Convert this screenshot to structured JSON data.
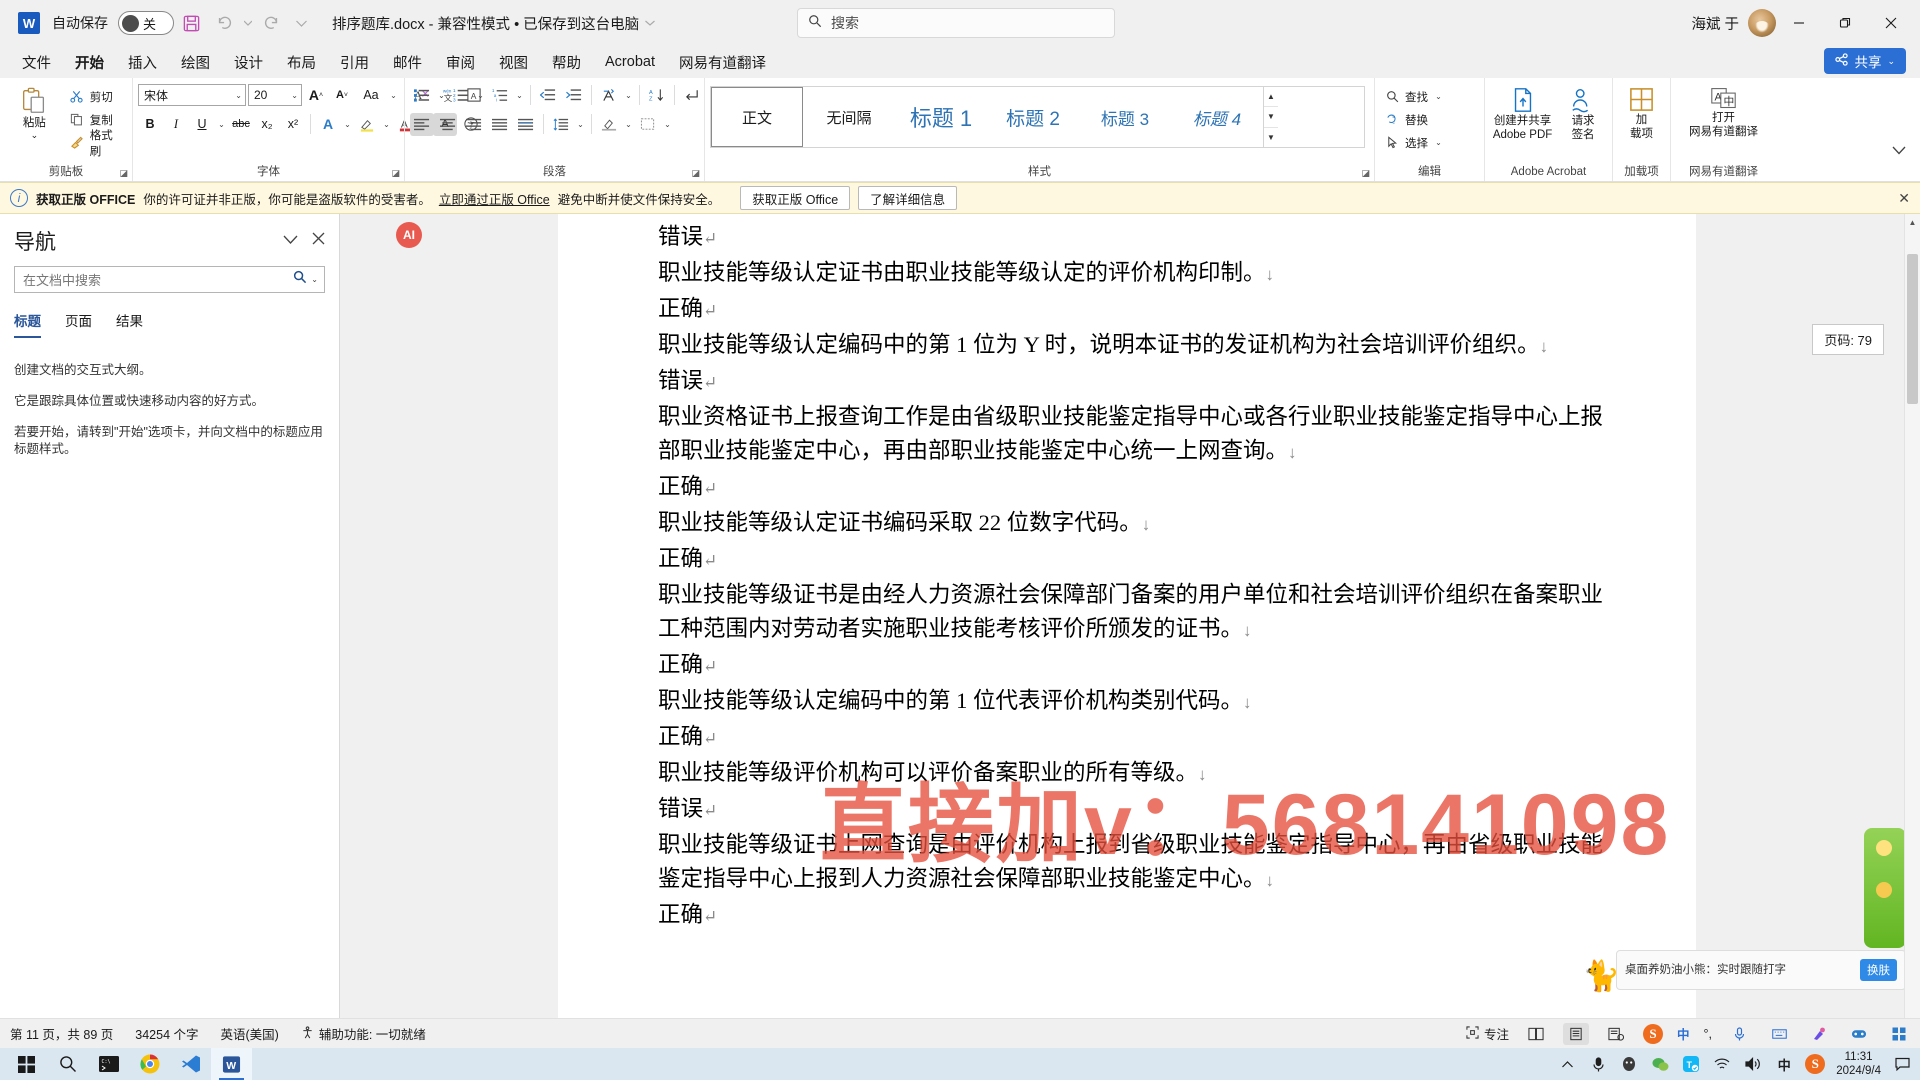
{
  "titlebar": {
    "app_icon": "word-logo",
    "autosave_label": "自动保存",
    "autosave_state": "关",
    "save_icon": "save-icon",
    "undo_icon": "undo-icon",
    "redo_icon": "redo-icon",
    "customize_icon": "chevron-down-icon",
    "doc_title": "排序题库.docx  -  兼容性模式 • 已保存到这台电脑",
    "user_name": "海斌 于",
    "minimize": "—",
    "maximize": "▢",
    "close": "✕"
  },
  "search": {
    "placeholder": "搜索",
    "icon": "search-icon"
  },
  "tabs": [
    {
      "label": "文件",
      "active": false
    },
    {
      "label": "开始",
      "active": true
    },
    {
      "label": "插入",
      "active": false
    },
    {
      "label": "绘图",
      "active": false
    },
    {
      "label": "设计",
      "active": false
    },
    {
      "label": "布局",
      "active": false
    },
    {
      "label": "引用",
      "active": false
    },
    {
      "label": "邮件",
      "active": false
    },
    {
      "label": "审阅",
      "active": false
    },
    {
      "label": "视图",
      "active": false
    },
    {
      "label": "帮助",
      "active": false
    },
    {
      "label": "Acrobat",
      "active": false
    },
    {
      "label": "网易有道翻译",
      "active": false
    }
  ],
  "share_button": {
    "label": "共享",
    "icon": "share-icon",
    "caret": "⌄",
    "color": "#2b6fd4"
  },
  "ribbon": {
    "clipboard": {
      "group_label": "剪贴板",
      "paste_label": "粘贴",
      "paste_caret": "⌄",
      "items": [
        {
          "label": "剪切",
          "icon": "scissors-icon"
        },
        {
          "label": "复制",
          "icon": "copy-icon"
        },
        {
          "label": "格式刷",
          "icon": "format-painter-icon"
        }
      ]
    },
    "font": {
      "group_label": "字体",
      "font_name": "宋体",
      "font_size": "20",
      "grow_icon": "grow-font-icon",
      "shrink_icon": "shrink-font-icon",
      "change_case": "Aa",
      "clear_format_icon": "clear-formatting-icon",
      "phonetic_icon": "phonetic-guide-icon",
      "char_border_icon": "character-border-icon",
      "bold": "B",
      "italic": "I",
      "underline": "U",
      "strike": "abc",
      "subscript": "x₂",
      "superscript": "x²",
      "text_effects_icon": "text-effects-icon",
      "highlight_icon": "highlight-color-icon",
      "font_color_icon": "font-color-icon",
      "char_shading_icon": "character-shading-icon",
      "enclose_icon": "enclose-character-icon"
    },
    "paragraph": {
      "group_label": "段落",
      "bullets_icon": "bullet-list-icon",
      "numbering_icon": "numbered-list-icon",
      "multilevel_icon": "multilevel-list-icon",
      "decrease_indent_icon": "decrease-indent-icon",
      "increase_indent_icon": "increase-indent-icon",
      "sort_cn_icon": "sort-chinese-icon",
      "sort_icon": "sort-az-icon",
      "show_marks_icon": "show-formatting-marks-icon",
      "align_left_icon": "align-left-icon",
      "align_center_icon": "align-center-icon",
      "align_right_icon": "align-right-icon",
      "justify_icon": "justify-icon",
      "distribute_icon": "distribute-icon",
      "line_spacing_icon": "line-spacing-icon",
      "shading_icon": "shading-icon",
      "borders_icon": "borders-icon"
    },
    "styles": {
      "group_label": "样式",
      "items": [
        {
          "label": "正文",
          "selected": true
        },
        {
          "label": "无间隔",
          "selected": false
        },
        {
          "label": "标题 1",
          "selected": false
        },
        {
          "label": "标题 2",
          "selected": false
        },
        {
          "label": "标题 3",
          "selected": false
        },
        {
          "label": "标题 4",
          "selected": false
        }
      ]
    },
    "editing": {
      "group_label": "编辑",
      "items": [
        {
          "label": "查找",
          "icon": "search-icon",
          "caret": "⌄"
        },
        {
          "label": "替换",
          "icon": "replace-icon",
          "caret": ""
        },
        {
          "label": "选择",
          "icon": "select-cursor-icon",
          "caret": "⌄"
        }
      ]
    },
    "acrobat": {
      "group_label": "Adobe Acrobat",
      "items": [
        {
          "label_line1": "创建并共享",
          "label_line2": "Adobe PDF",
          "icon": "create-pdf-icon"
        },
        {
          "label_line1": "请求",
          "label_line2": "签名",
          "icon": "request-signature-icon"
        }
      ]
    },
    "addins": {
      "group_label": "加载项",
      "label_line1": "加",
      "label_line2": "载项",
      "icon": "addins-grid-icon"
    },
    "youdao": {
      "group_label": "网易有道翻译",
      "label_line1": "打开",
      "label_line2": "网易有道翻译",
      "icon": "translate-icon"
    },
    "collapse_icon": "chevron-up-icon"
  },
  "infobar": {
    "icon": "info-icon",
    "strong": "获取正版 OFFICE",
    "text_before": "你的许可证并非正版，你可能是盗版软件的受害者。",
    "link_text": "立即通过正版 Office",
    "text_after": "避免中断并使文件保持安全。",
    "primary_button": "获取正版 Office",
    "secondary_button": "了解详细信息",
    "close_icon": "close-icon"
  },
  "navigation": {
    "title": "导航",
    "collapse_icon": "chevron-down-icon",
    "close_icon": "close-icon",
    "search_placeholder": "在文档中搜索",
    "search_icon": "search-icon",
    "search_caret": "⌄",
    "tabs": [
      {
        "label": "标题",
        "active": true
      },
      {
        "label": "页面",
        "active": false
      },
      {
        "label": "结果",
        "active": false
      }
    ],
    "body": [
      "创建文档的交互式大纲。",
      "它是跟踪具体位置或快速移动内容的好方式。",
      "若要开始，请转到\"开始\"选项卡，并向文档中的标题应用标题样式。"
    ]
  },
  "document": {
    "ai_badge": "AI",
    "page_tooltip": "页码: 79",
    "watermark": "直接加v：568141098",
    "lines": [
      {
        "text": "错误",
        "mark": "pilcrow"
      },
      {
        "text": "职业技能等级认定证书由职业技能等级认定的评价机构印制。",
        "mark": "arrow"
      },
      {
        "text": "正确",
        "mark": "pilcrow"
      },
      {
        "text": "职业技能等级认定编码中的第 1 位为 Y 时，说明本证书的发证机构为社会培训评价组织。",
        "mark": "arrow"
      },
      {
        "text": "错误",
        "mark": "pilcrow"
      },
      {
        "text": "职业资格证书上报查询工作是由省级职业技能鉴定指导中心或各行业职业技能鉴定指导中心上报部职业技能鉴定中心，再由部职业技能鉴定中心统一上网查询。",
        "mark": "arrow"
      },
      {
        "text": "正确",
        "mark": "pilcrow"
      },
      {
        "text": "职业技能等级认定证书编码采取 22 位数字代码。",
        "mark": "arrow"
      },
      {
        "text": "正确",
        "mark": "pilcrow"
      },
      {
        "text": "职业技能等级证书是由经人力资源社会保障部门备案的用户单位和社会培训评价组织在备案职业工种范围内对劳动者实施职业技能考核评价所颁发的证书。",
        "mark": "arrow"
      },
      {
        "text": "正确",
        "mark": "pilcrow"
      },
      {
        "text": "职业技能等级认定编码中的第 1 位代表评价机构类别代码。",
        "mark": "arrow"
      },
      {
        "text": "正确",
        "mark": "pilcrow"
      },
      {
        "text": "职业技能等级评价机构可以评价备案职业的所有等级。",
        "mark": "arrow"
      },
      {
        "text": "错误",
        "mark": "pilcrow"
      },
      {
        "text": "职业技能等级证书上网查询是由评价机构上报到省级职业技能鉴定指导中心，再由省级职业技能鉴定指导中心上报到人力资源社会保障部职业技能鉴定中心。",
        "mark": "arrow"
      },
      {
        "text": "正确",
        "mark": "pilcrow"
      }
    ]
  },
  "ad": {
    "text": "桌面养奶油小熊：实时跟随打字",
    "button": "换肤",
    "cat_icon": "cat-icon"
  },
  "statusbar": {
    "page_info": "第 11 页，共 89 页",
    "word_count": "34254 个字",
    "language": "英语(美国)",
    "accessibility_icon": "accessibility-icon",
    "accessibility": "辅助功能: 一切就绪",
    "focus_icon": "focus-icon",
    "focus_label": "专注",
    "view_read_icon": "read-mode-icon",
    "view_print_icon": "print-layout-icon",
    "view_web_icon": "web-layout-icon"
  },
  "ime": {
    "logo": "S",
    "mode": "中",
    "punct": "°,",
    "mic_icon": "microphone-icon",
    "keyboard_icon": "keyboard-icon",
    "tools_icon": "tools-icon",
    "game_icon": "gamepad-icon",
    "apps_icon": "apps-icon"
  },
  "taskbar": {
    "apps": [
      {
        "name": "start-button",
        "icon": "windows-logo-icon",
        "active": false
      },
      {
        "name": "search-button",
        "icon": "search-icon",
        "active": false
      },
      {
        "name": "terminal",
        "icon": "terminal-icon",
        "active": false
      },
      {
        "name": "chrome",
        "icon": "chrome-icon",
        "active": false
      },
      {
        "name": "vscode",
        "icon": "vscode-icon",
        "active": false
      },
      {
        "name": "word",
        "icon": "word-icon",
        "active": true
      }
    ],
    "tray": {
      "expand_icon": "chevron-up-icon",
      "mic_icon": "microphone-icon",
      "qq_icon": "qq-icon",
      "wechat_icon": "wechat-icon",
      "tim_icon": "tim-icon",
      "network_icon": "wifi-icon",
      "volume_icon": "volume-icon",
      "ime_icon": "中",
      "sogou_icon": "S",
      "time": "11:31",
      "date": "2024/9/4",
      "notification_icon": "notification-icon"
    }
  }
}
